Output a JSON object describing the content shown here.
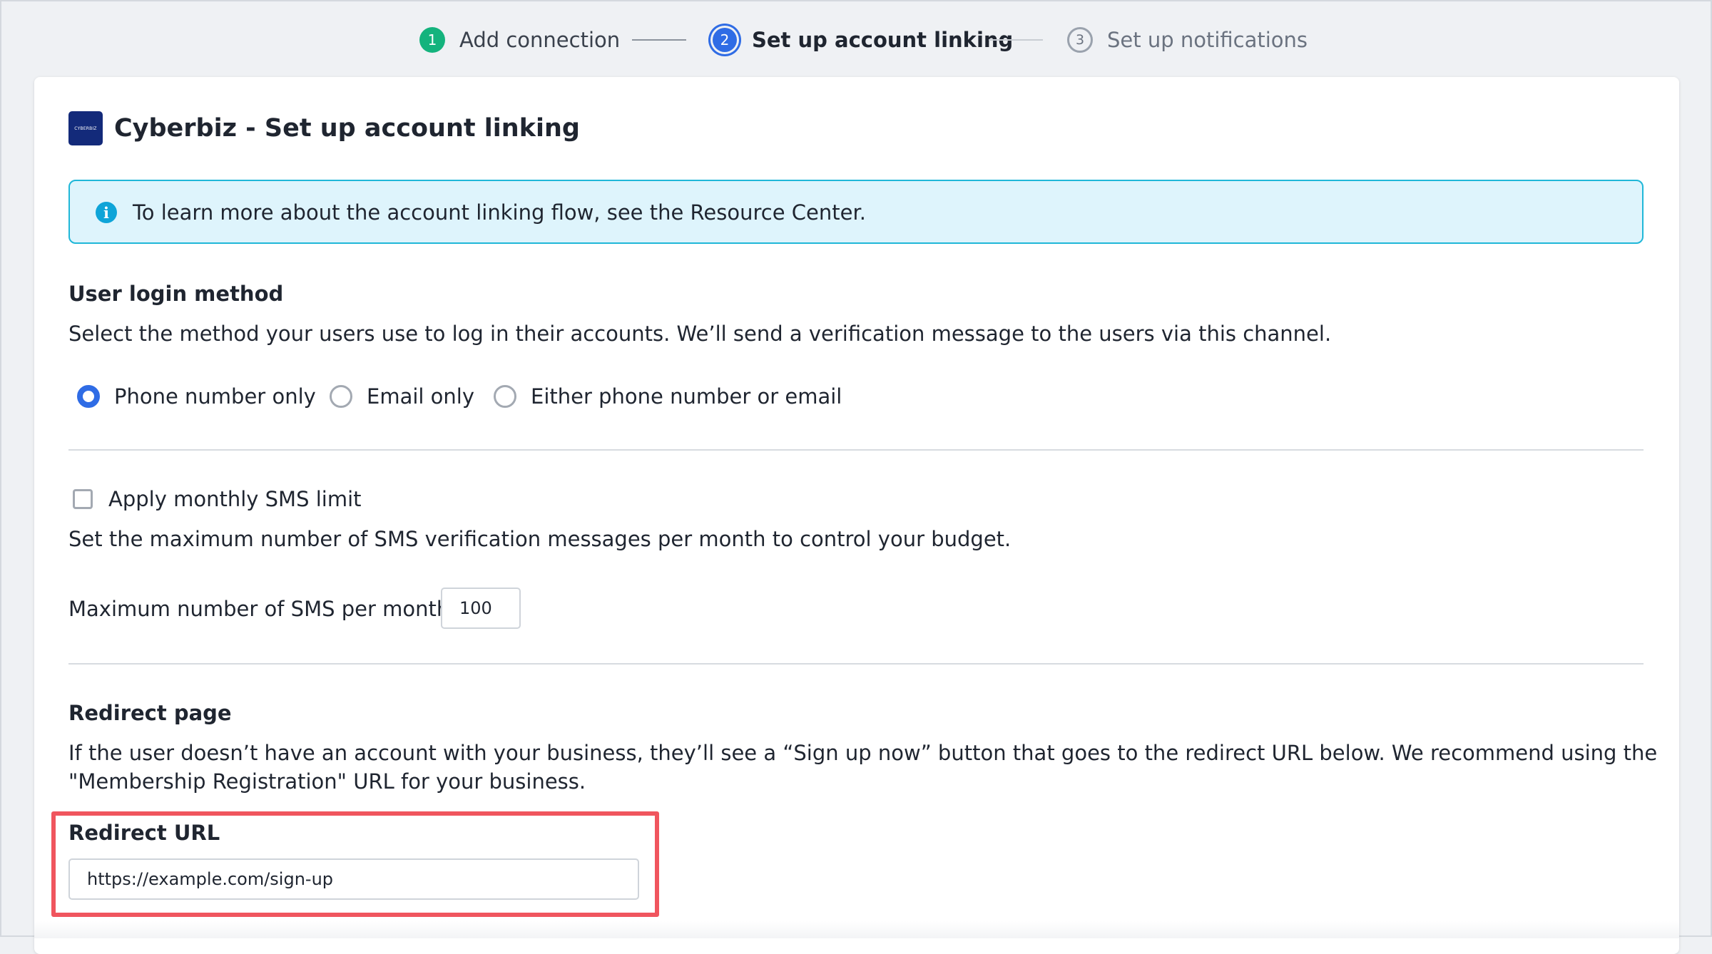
{
  "stepper": {
    "steps": [
      {
        "number": "1",
        "label": "Add connection",
        "state": "done"
      },
      {
        "number": "2",
        "label": "Set up account linking",
        "state": "active"
      },
      {
        "number": "3",
        "label": "Set up notifications",
        "state": "todo"
      }
    ]
  },
  "card": {
    "logo_text": "CYBERBIZ",
    "title": "Cyberbiz - Set up account linking"
  },
  "info_banner": {
    "icon": "info-icon",
    "text": "To learn more about the account linking flow, see the Resource Center."
  },
  "login_method": {
    "title": "User login method",
    "description": "Select the method your users use to log in their accounts. We’ll send a verification message to the users via this channel.",
    "options": [
      {
        "label": "Phone number only",
        "checked": true
      },
      {
        "label": "Email only",
        "checked": false
      },
      {
        "label": "Either phone number or email",
        "checked": false
      }
    ]
  },
  "sms_limit": {
    "checkbox_label": "Apply monthly SMS limit",
    "checked": false,
    "description": "Set the maximum number of SMS verification messages per month to control your budget.",
    "max_label": "Maximum number of SMS per month:",
    "max_value": "100"
  },
  "redirect": {
    "title": "Redirect page",
    "description_line1": "If the user doesn’t have an account with your business, they’ll see a “Sign up now” button that goes to the redirect URL below. We recommend using the",
    "description_line2": "\"Membership Registration\" URL for your business.",
    "url_label": "Redirect URL",
    "url_value": "https://example.com/sign-up"
  },
  "colors": {
    "accent": "#2f6ce5",
    "success": "#14b37d",
    "info_bg": "#def4fc",
    "info_border": "#1fb7d8",
    "highlight": "#f0555e"
  }
}
